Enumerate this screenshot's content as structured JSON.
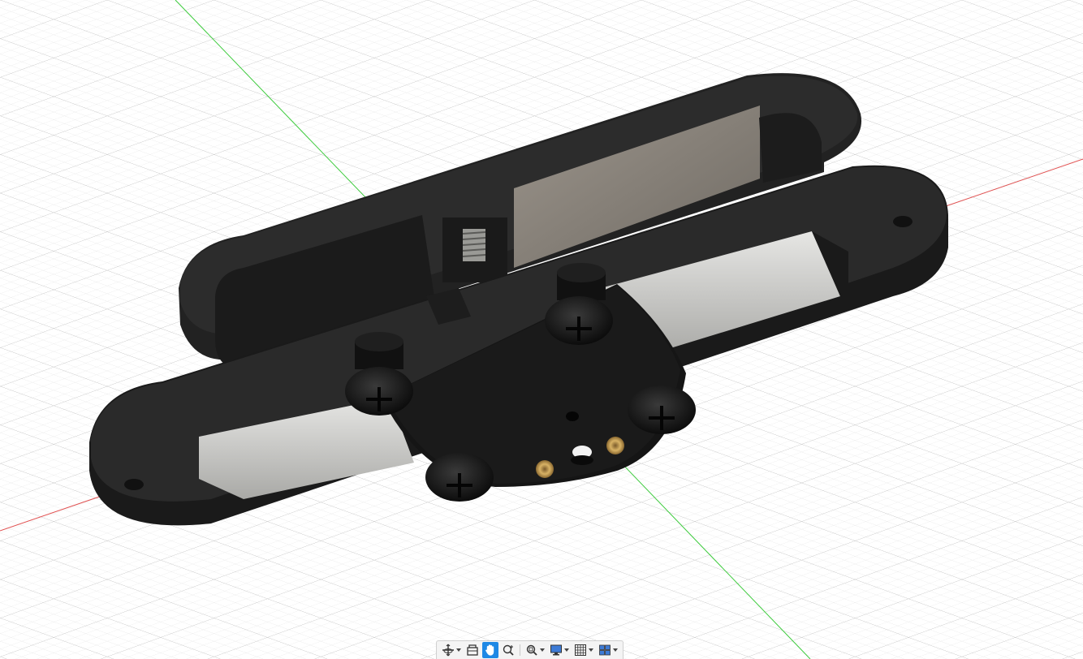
{
  "app": {
    "kind": "cad-3d-viewport",
    "background_color": "#ffffff",
    "grid_color": "#c9c9c9",
    "x_axis_color": "#e05050",
    "y_axis_color": "#3ccb3c"
  },
  "model": {
    "body_color": "#262626",
    "glass_color": "#8d8880",
    "insert_color": "#c39a4c"
  },
  "navigation_toolbar": {
    "tools": [
      {
        "id": "orbit",
        "icon": "orbit-icon",
        "has_dropdown": true,
        "active": false
      },
      {
        "id": "look-at",
        "icon": "look-at-icon",
        "has_dropdown": false,
        "active": false
      },
      {
        "id": "pan",
        "icon": "pan-hand-icon",
        "has_dropdown": false,
        "active": true
      },
      {
        "id": "zoom",
        "icon": "zoom-icon",
        "has_dropdown": false,
        "active": false
      },
      {
        "id": "fit",
        "icon": "fit-window-icon",
        "has_dropdown": true,
        "active": false
      },
      {
        "id": "display-settings",
        "icon": "display-settings-icon",
        "has_dropdown": true,
        "active": false
      },
      {
        "id": "grid-snaps",
        "icon": "grid-icon",
        "has_dropdown": true,
        "active": false
      },
      {
        "id": "viewports",
        "icon": "viewports-icon",
        "has_dropdown": true,
        "active": false
      }
    ],
    "accent_color": "#1e88e5"
  }
}
